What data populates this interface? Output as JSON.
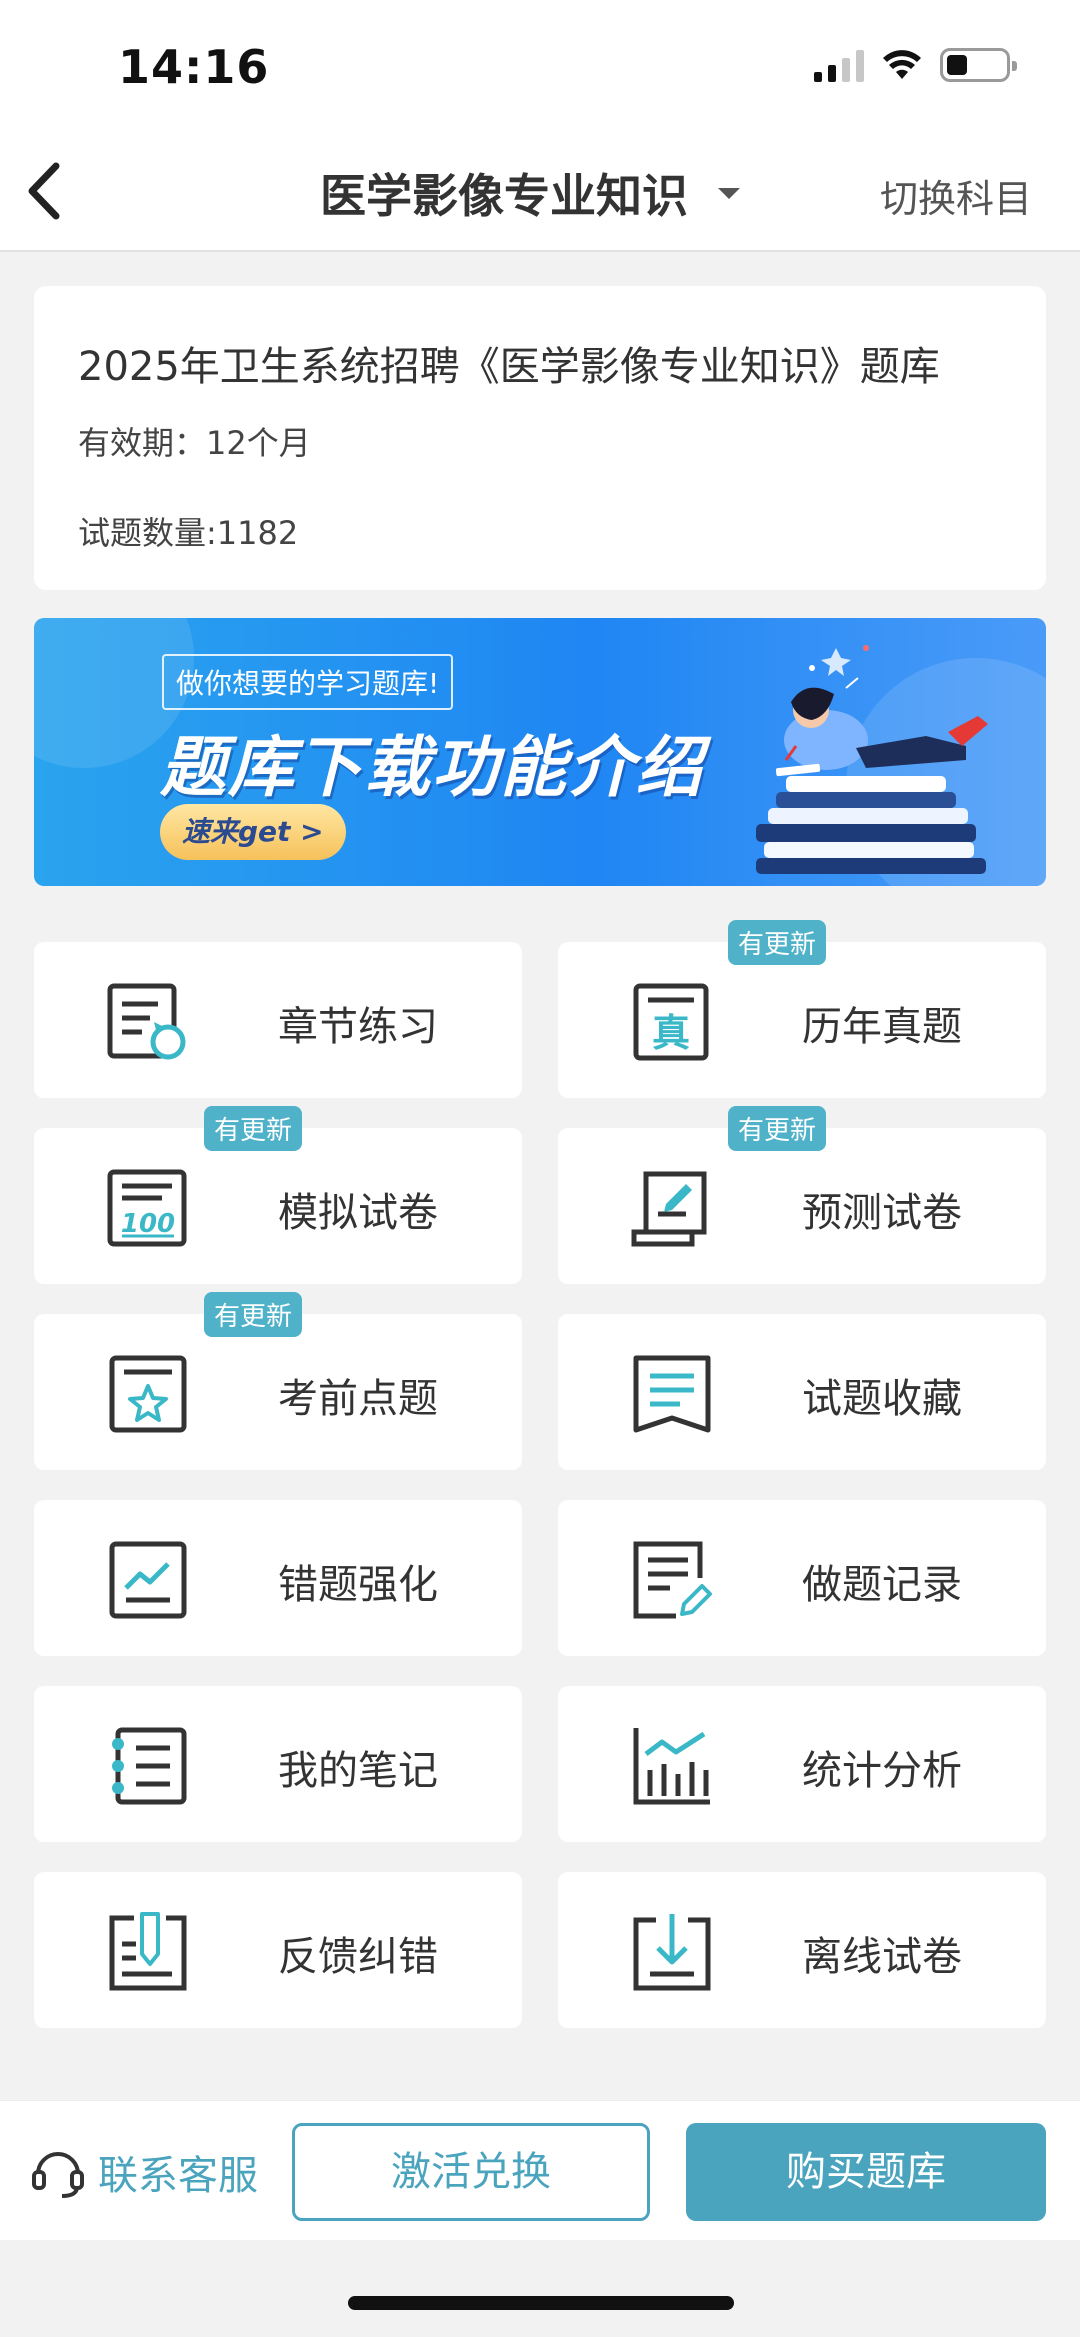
{
  "status_bar": {
    "time": "14:16"
  },
  "nav": {
    "title": "医学影像专业知识",
    "switch_label": "切换科目"
  },
  "info": {
    "title": "2025年卫生系统招聘《医学影像专业知识》题库",
    "validity": "有效期：12个月",
    "question_count": "试题数量:1182"
  },
  "banner": {
    "tag": "做你想要的学习题库!",
    "headline": "题库下载功能介绍",
    "button": "速来get >"
  },
  "grid": [
    {
      "label": "章节练习",
      "icon": "chapter-practice-icon",
      "badge": ""
    },
    {
      "label": "历年真题",
      "icon": "past-exam-icon",
      "badge": "有更新"
    },
    {
      "label": "模拟试卷",
      "icon": "mock-exam-icon",
      "badge": "有更新"
    },
    {
      "label": "预测试卷",
      "icon": "prediction-exam-icon",
      "badge": "有更新"
    },
    {
      "label": "考前点题",
      "icon": "pre-exam-tips-icon",
      "badge": "有更新"
    },
    {
      "label": "试题收藏",
      "icon": "bookmark-icon",
      "badge": ""
    },
    {
      "label": "错题强化",
      "icon": "mistake-review-icon",
      "badge": ""
    },
    {
      "label": "做题记录",
      "icon": "practice-record-icon",
      "badge": ""
    },
    {
      "label": "我的笔记",
      "icon": "notes-icon",
      "badge": ""
    },
    {
      "label": "统计分析",
      "icon": "statistics-icon",
      "badge": ""
    },
    {
      "label": "反馈纠错",
      "icon": "feedback-icon",
      "badge": ""
    },
    {
      "label": "离线试卷",
      "icon": "offline-download-icon",
      "badge": ""
    }
  ],
  "bottom": {
    "customer_service": "联系客服",
    "activate": "激活兑换",
    "buy": "购买题库"
  },
  "colors": {
    "accent": "#4aa4bd",
    "badge": "#4fb2c9",
    "icon_teal": "#3bb8c8",
    "icon_dark": "#333333"
  }
}
